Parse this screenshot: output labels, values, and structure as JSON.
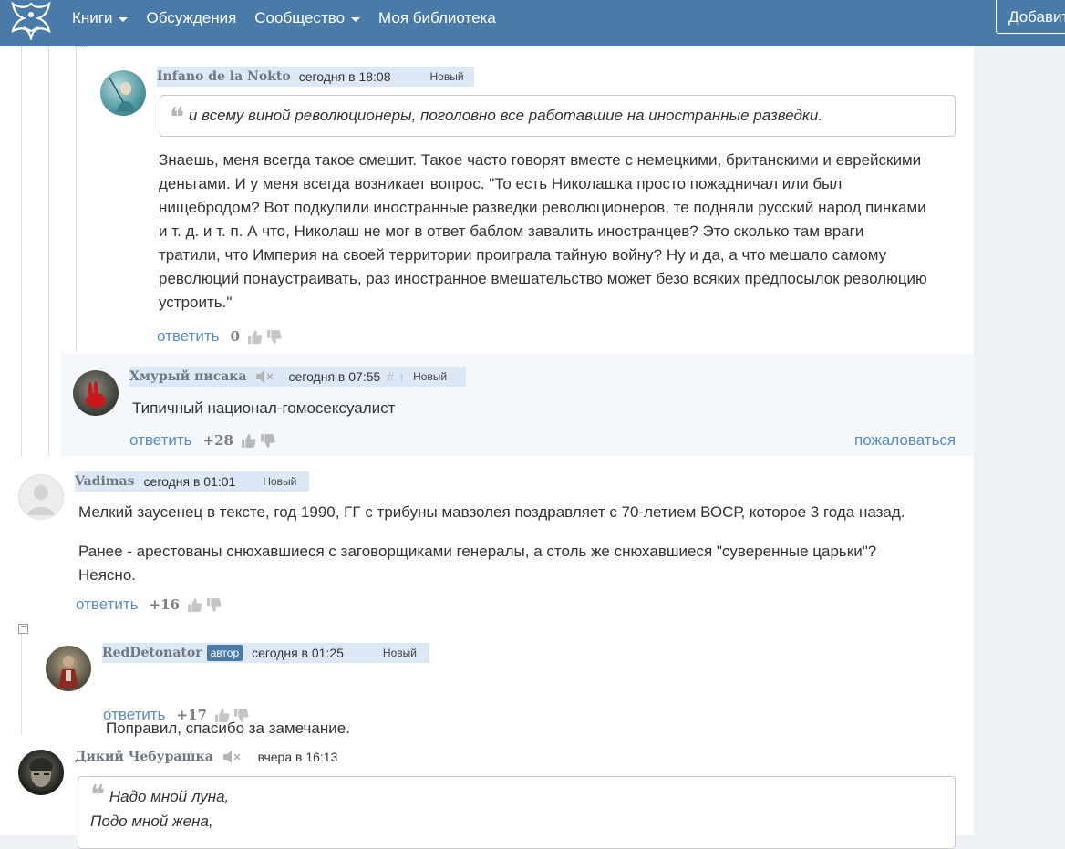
{
  "nav": {
    "items": [
      {
        "label": "Книги",
        "dropdown": true
      },
      {
        "label": "Обсуждения",
        "dropdown": false
      },
      {
        "label": "Сообщество",
        "dropdown": true
      },
      {
        "label": "Моя библиотека",
        "dropdown": false
      }
    ],
    "add_button": "Добавить"
  },
  "colors": {
    "nav_bg": "#4a7aa8",
    "link": "#5b8cc0",
    "meta_bg": "#dce8f6"
  },
  "comments": [
    {
      "author": "Infano de la Nokto",
      "time": "сегодня в 18:08",
      "new_label": "Новый",
      "quote": "и всему виной революционеры, поголовно все работавшие на иностранные разведки.",
      "text_lines": [
        "Знаешь, меня всегда такое смешит. Такое часто говорят вместе с немецкими, британскими и еврейскими",
        "деньгами. И у меня всегда возникает вопрос. \"То есть Николашка просто пожадничал или был",
        "нищебродом? Вот подкупили иностранные разведки революционеров, те подняли русский народ пинками",
        "и т. д. и т. п. А что, Николаш не мог в ответ баблом завалить иностранцев? Это сколько там враги",
        "тратили, что Империя на своей территории проиграла тайную войну? Ну и да, а что мешало самому",
        "революций понаустраивать, раз иностранное вмешательство может безо всяких предпосылок революцию",
        "устроить.\""
      ],
      "reply_label": "ответить",
      "score": "0"
    },
    {
      "author": "Хмурый писака",
      "time": "сегодня в 07:55",
      "hash": "#",
      "arrow": "↑",
      "new_label": "Новый",
      "text": "Типичный национал-гомосексуалист",
      "reply_label": "ответить",
      "score": "+28",
      "report_label": "пожаловаться"
    },
    {
      "author": "Vadimas",
      "time": "сегодня в 01:01",
      "new_label": "Новый",
      "paragraph1": "Мелкий заусенец в тексте, год 1990, ГГ с трибуны мавзолея поздравляет с 70-летием ВОСР, которое 3 года назад.",
      "paragraph2_lines": [
        "Ранее - арестованы снюхавшиеся с заговорщиками генералы, а столь же  снюхавшиеся \"суверенные царьки\"?",
        "Неясно."
      ],
      "reply_label": "ответить",
      "score": "+16"
    },
    {
      "author": "RedDetonator",
      "author_badge": "автор",
      "time": "сегодня в 01:25",
      "new_label": "Новый",
      "text": "Поправил, спасибо за замечание.",
      "reply_label": "ответить",
      "score": "+17"
    },
    {
      "author": "Дикий Чебурашка",
      "time": "вчера в 16:13",
      "quote_lines": [
        "Надо мной луна,",
        "Подо мной жена,"
      ]
    }
  ]
}
